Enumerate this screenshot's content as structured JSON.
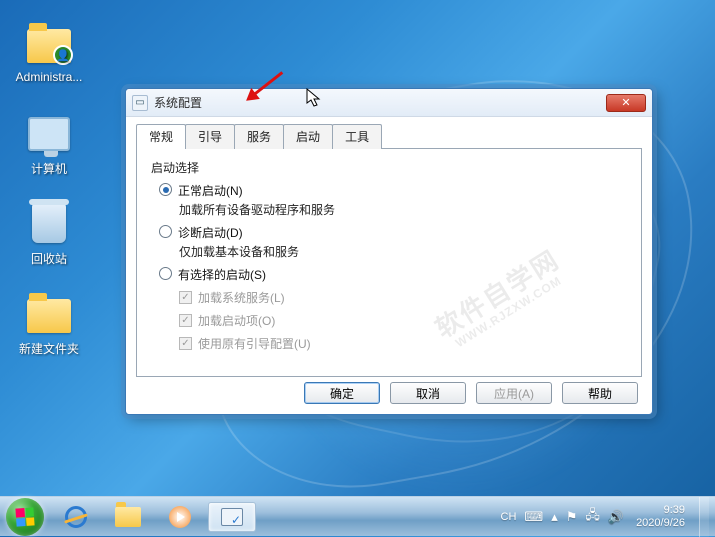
{
  "desktop": {
    "icons": [
      {
        "label": "Administra..."
      },
      {
        "label": "计算机"
      },
      {
        "label": "回收站"
      },
      {
        "label": "新建文件夹"
      }
    ]
  },
  "dialog": {
    "title": "系统配置",
    "tabs": [
      "常规",
      "引导",
      "服务",
      "启动",
      "工具"
    ],
    "active_tab_index": 0,
    "group_title": "启动选择",
    "options": {
      "normal": {
        "label": "正常启动(N)",
        "sub": "加载所有设备驱动程序和服务"
      },
      "diag": {
        "label": "诊断启动(D)",
        "sub": "仅加载基本设备和服务"
      },
      "select": {
        "label": "有选择的启动(S)"
      }
    },
    "checks": {
      "services": "加载系统服务(L)",
      "startup": "加载启动项(O)",
      "bootcfg": "使用原有引导配置(U)"
    },
    "buttons": {
      "ok": "确定",
      "cancel": "取消",
      "apply": "应用(A)",
      "help": "帮助"
    }
  },
  "watermark": {
    "line1": "软件自学网",
    "line2": "WWW.RJZXW.COM"
  },
  "taskbar": {
    "ime": "CH",
    "clock_time": "9:39",
    "clock_date": "2020/9/26"
  }
}
